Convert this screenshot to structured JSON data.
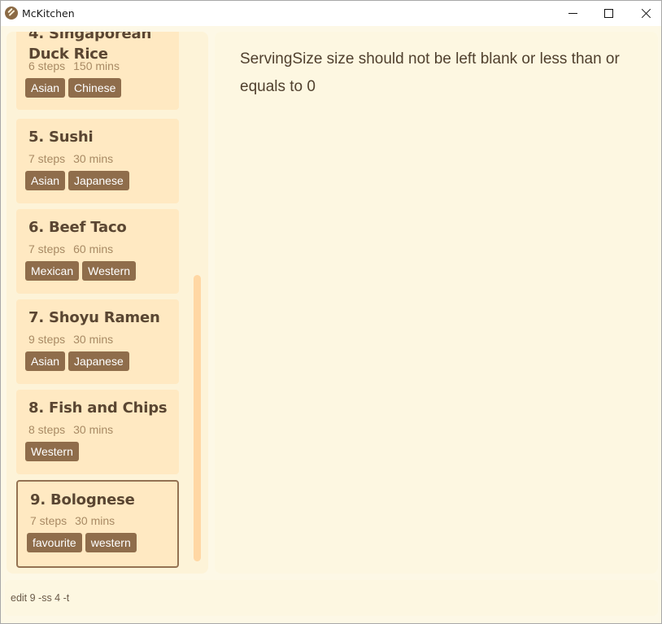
{
  "window": {
    "title": "McKitchen",
    "controls": {
      "minimize": "minimize",
      "maximize": "maximize",
      "close": "close"
    }
  },
  "recipes": [
    {
      "title": "4. Singaporean Duck Rice",
      "steps": "6 steps",
      "time": "150 mins",
      "tags": [
        "Asian",
        "Chinese"
      ]
    },
    {
      "title": "5. Sushi",
      "steps": "7 steps",
      "time": "30 mins",
      "tags": [
        "Asian",
        "Japanese"
      ]
    },
    {
      "title": "6. Beef Taco",
      "steps": "7 steps",
      "time": "60 mins",
      "tags": [
        "Mexican",
        "Western"
      ]
    },
    {
      "title": "7. Shoyu Ramen",
      "steps": "9 steps",
      "time": "30 mins",
      "tags": [
        "Asian",
        "Japanese"
      ]
    },
    {
      "title": "8. Fish and Chips",
      "steps": "8 steps",
      "time": "30 mins",
      "tags": [
        "Western"
      ]
    },
    {
      "title": "9. Bolognese",
      "steps": "7 steps",
      "time": "30 mins",
      "tags": [
        "favourite",
        "western"
      ],
      "selected": true
    }
  ],
  "result": {
    "message": "ServingSize size should not be left blank or less than or equals to 0"
  },
  "command": {
    "value": "edit 9 -ss 4 -t"
  },
  "colors": {
    "background": "#fdf8e6",
    "card": "#ffe9c2",
    "tag": "#8f6d4b",
    "title_text": "#5a4632",
    "meta_text": "#a88a64",
    "scrollbar": "#ffd7a4"
  }
}
